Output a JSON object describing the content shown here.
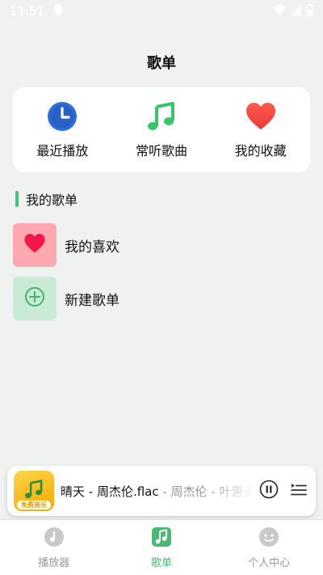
{
  "status": {
    "time": "11:51"
  },
  "page": {
    "title": "歌单"
  },
  "quick_actions": [
    {
      "label": "最近播放",
      "icon": "clock-icon",
      "color": "#2d6ed8"
    },
    {
      "label": "常听歌曲",
      "icon": "music-note-icon",
      "color": "#39c46a"
    },
    {
      "label": "我的收藏",
      "icon": "heart-icon",
      "color": "#ef4545"
    }
  ],
  "section": {
    "title": "我的歌单"
  },
  "playlists": [
    {
      "label": "我的喜欢",
      "icon": "heart-icon",
      "color": "#ffa8b2"
    },
    {
      "label": "新建歌单",
      "icon": "add-circle-icon",
      "color": "#c9ead5"
    }
  ],
  "mini_player": {
    "song": "晴天 - 周杰伦.flac",
    "artist": " - 周杰伦 - 叶惠美",
    "cover_badge": "免费音乐"
  },
  "nav": {
    "items": [
      {
        "label": "播放器",
        "icon": "player-icon"
      },
      {
        "label": "歌单",
        "icon": "playlist-icon",
        "active": true
      },
      {
        "label": "个人中心",
        "icon": "profile-icon"
      }
    ],
    "accent": "#4cb878"
  }
}
